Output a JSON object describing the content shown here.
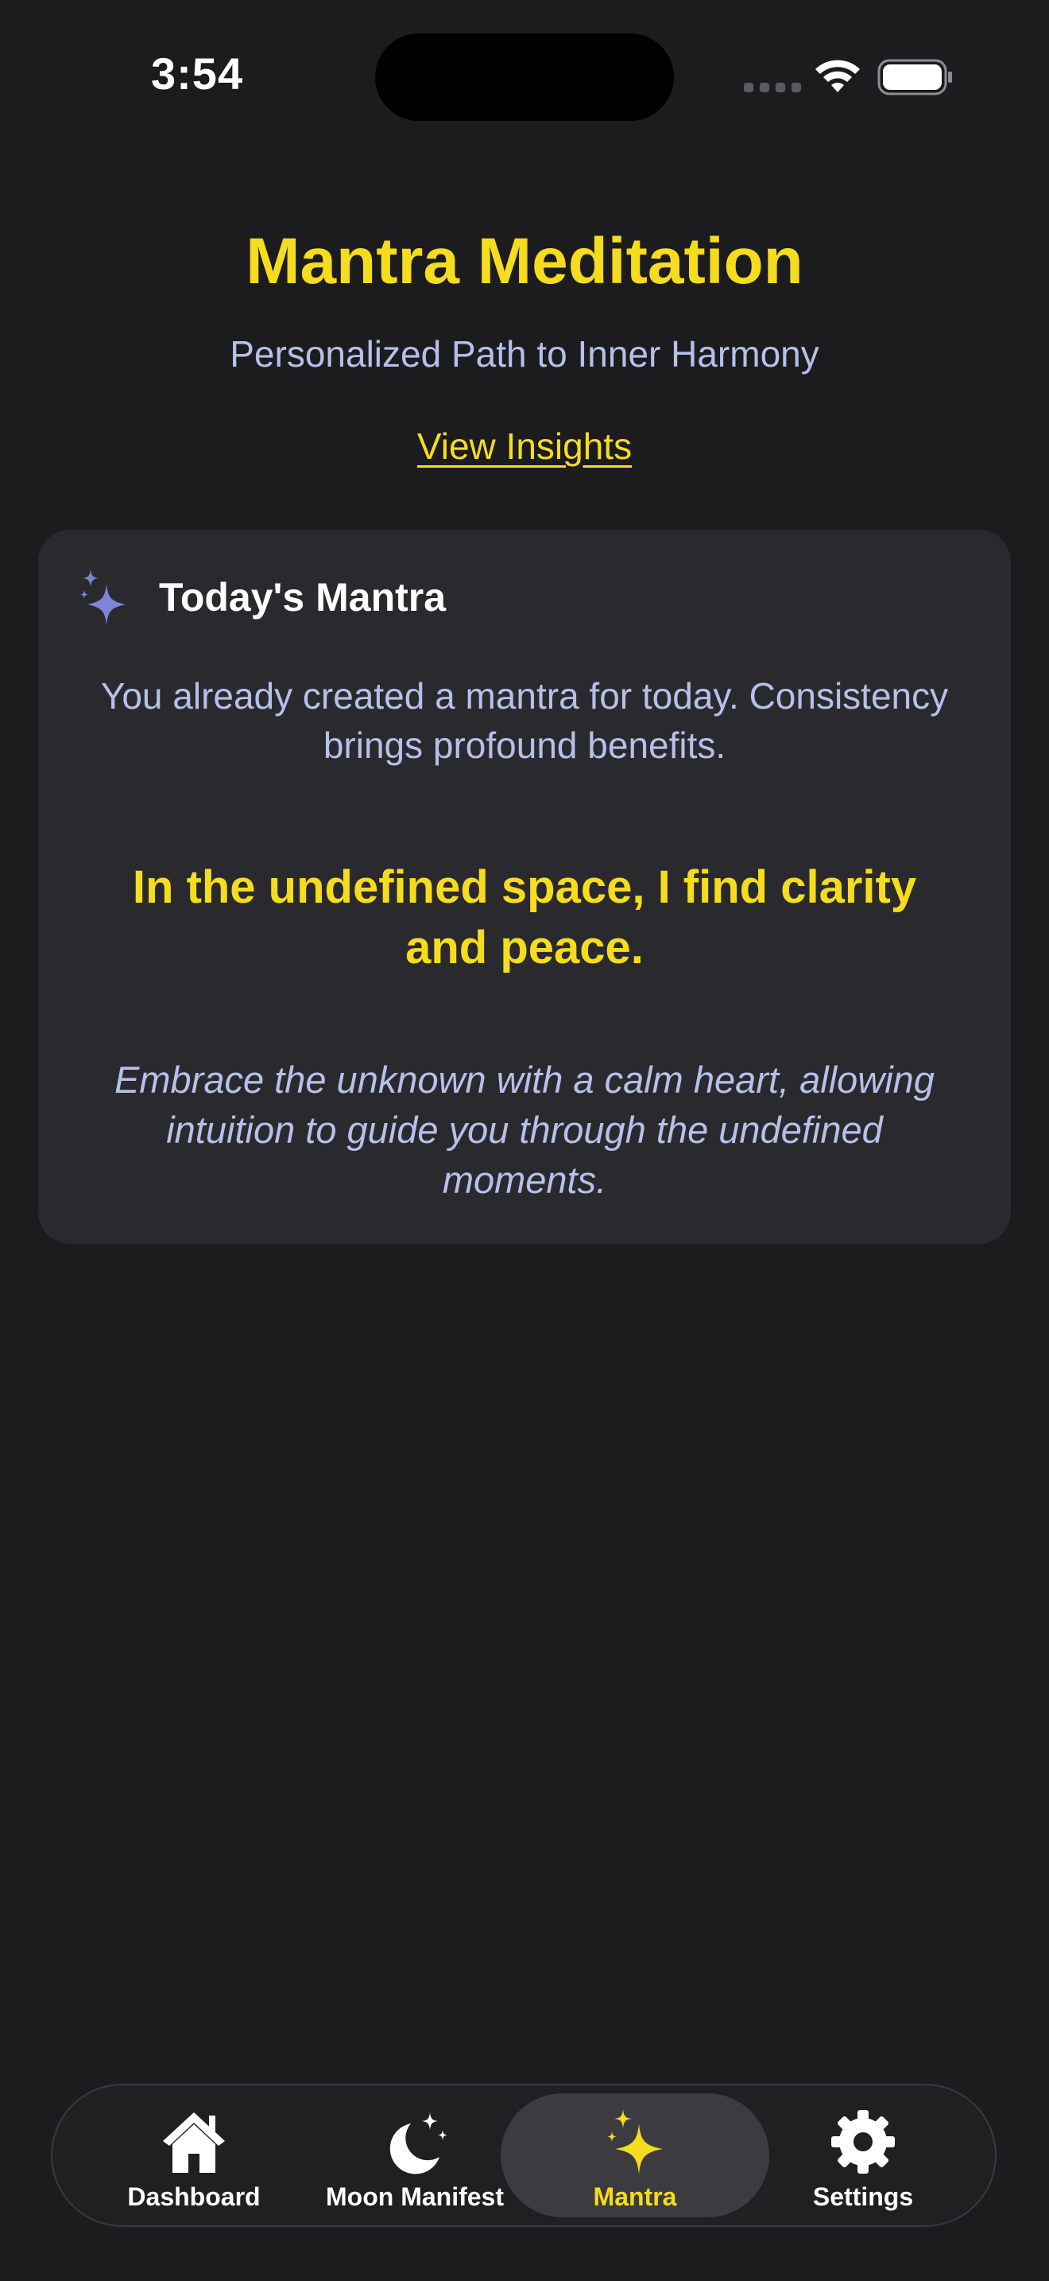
{
  "status_bar": {
    "time": "3:54"
  },
  "header": {
    "title": "Mantra Meditation",
    "subtitle": "Personalized Path to Inner Harmony",
    "insights_link": "View Insights"
  },
  "card": {
    "icon": "sparkles-icon",
    "title": "Today's Mantra",
    "notice": "You already created a mantra for today. Consistency brings profound benefits.",
    "mantra": "In the undefined space, I find clarity and peace.",
    "reflection": "Embrace the unknown with a calm heart, allowing intuition to guide you through the undefined moments."
  },
  "tab_bar": {
    "active": "Mantra",
    "tabs": [
      {
        "label": "Dashboard",
        "icon": "house-icon"
      },
      {
        "label": "Moon Manifest",
        "icon": "moon-stars-icon"
      },
      {
        "label": "Mantra",
        "icon": "sparkles-icon"
      },
      {
        "label": "Settings",
        "icon": "gear-icon"
      }
    ]
  },
  "colors": {
    "background": "#1c1c1e",
    "accent_yellow": "#f5dc1e",
    "text_lavender": "#b6c0ea",
    "card_bg": "#2a2a2e",
    "icon_periwinkle": "#7d86d6"
  }
}
